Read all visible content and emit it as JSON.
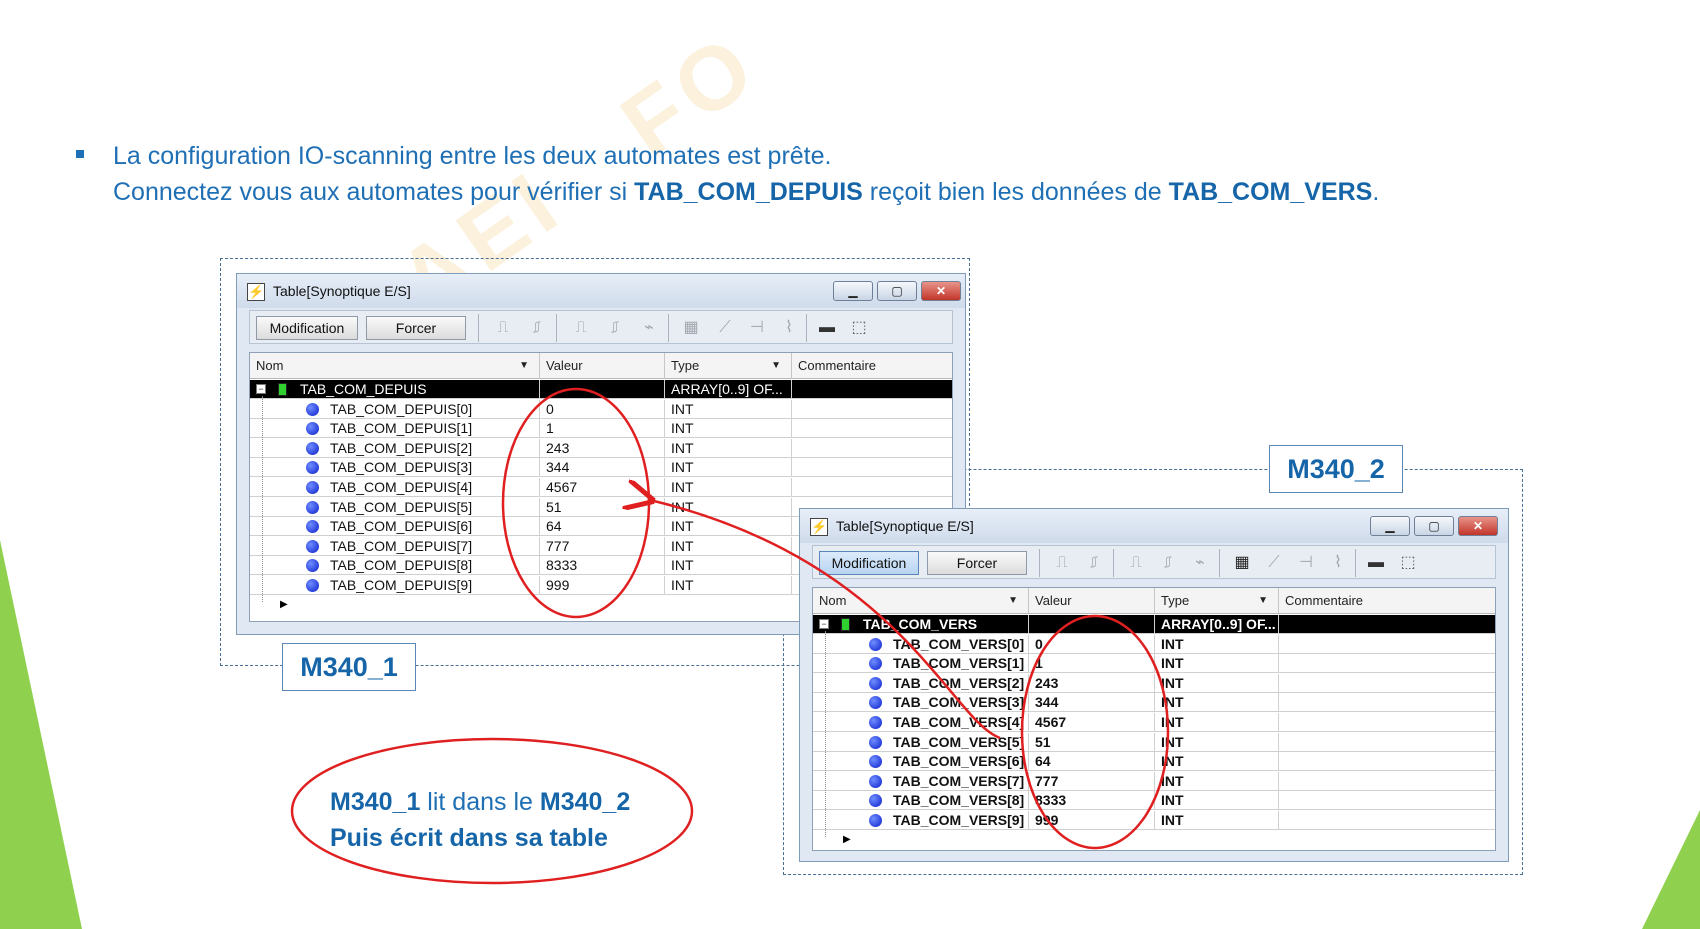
{
  "bullet": {
    "line1": "La configuration IO-scanning entre les deux automates est prête.",
    "line2_pre": "Connectez vous aux automates pour vérifier si ",
    "line2_b1": "TAB_COM_DEPUIS",
    "line2_mid": " reçoit bien les données de ",
    "line2_b2": "TAB_COM_VERS",
    "line2_end": "."
  },
  "labels": {
    "m1": "M340_1",
    "m2": "M340_2"
  },
  "note": {
    "l1_b1": "M340_1",
    "l1_mid": " lit dans le ",
    "l1_b2": "M340_2",
    "l2": "Puis écrit  dans sa table"
  },
  "windows": {
    "w1": {
      "title": "Table[Synoptique E/S]",
      "btn_modification": "Modification",
      "btn_forcer": "Forcer",
      "headers": {
        "nom": "Nom",
        "valeur": "Valeur",
        "type": "Type",
        "commentaire": "Commentaire"
      },
      "root": {
        "name": "TAB_COM_DEPUIS",
        "type": "ARRAY[0..9] OF..."
      },
      "rows": [
        {
          "name": "TAB_COM_DEPUIS[0]",
          "value": "0",
          "type": "INT"
        },
        {
          "name": "TAB_COM_DEPUIS[1]",
          "value": "1",
          "type": "INT"
        },
        {
          "name": "TAB_COM_DEPUIS[2]",
          "value": "243",
          "type": "INT"
        },
        {
          "name": "TAB_COM_DEPUIS[3]",
          "value": "344",
          "type": "INT"
        },
        {
          "name": "TAB_COM_DEPUIS[4]",
          "value": "4567",
          "type": "INT"
        },
        {
          "name": "TAB_COM_DEPUIS[5]",
          "value": "51",
          "type": "INT"
        },
        {
          "name": "TAB_COM_DEPUIS[6]",
          "value": "64",
          "type": "INT"
        },
        {
          "name": "TAB_COM_DEPUIS[7]",
          "value": "777",
          "type": "INT"
        },
        {
          "name": "TAB_COM_DEPUIS[8]",
          "value": "8333",
          "type": "INT"
        },
        {
          "name": "TAB_COM_DEPUIS[9]",
          "value": "999",
          "type": "INT"
        }
      ]
    },
    "w2": {
      "title": "Table[Synoptique E/S]",
      "btn_modification": "Modification",
      "btn_forcer": "Forcer",
      "headers": {
        "nom": "Nom",
        "valeur": "Valeur",
        "type": "Type",
        "commentaire": "Commentaire"
      },
      "root": {
        "name": "TAB_COM_VERS",
        "type": "ARRAY[0..9] OF..."
      },
      "rows": [
        {
          "name": "TAB_COM_VERS[0]",
          "value": "0",
          "type": "INT"
        },
        {
          "name": "TAB_COM_VERS[1]",
          "value": "1",
          "type": "INT"
        },
        {
          "name": "TAB_COM_VERS[2]",
          "value": "243",
          "type": "INT"
        },
        {
          "name": "TAB_COM_VERS[3]",
          "value": "344",
          "type": "INT"
        },
        {
          "name": "TAB_COM_VERS[4]",
          "value": "4567",
          "type": "INT"
        },
        {
          "name": "TAB_COM_VERS[5]",
          "value": "51",
          "type": "INT"
        },
        {
          "name": "TAB_COM_VERS[6]",
          "value": "64",
          "type": "INT"
        },
        {
          "name": "TAB_COM_VERS[7]",
          "value": "777",
          "type": "INT"
        },
        {
          "name": "TAB_COM_VERS[8]",
          "value": "8333",
          "type": "INT"
        },
        {
          "name": "TAB_COM_VERS[9]",
          "value": "999",
          "type": "INT"
        }
      ]
    }
  },
  "colors": {
    "accent": "#1f6fb5",
    "annotation_red": "#e02020",
    "slide_green": "#8fd14f"
  }
}
